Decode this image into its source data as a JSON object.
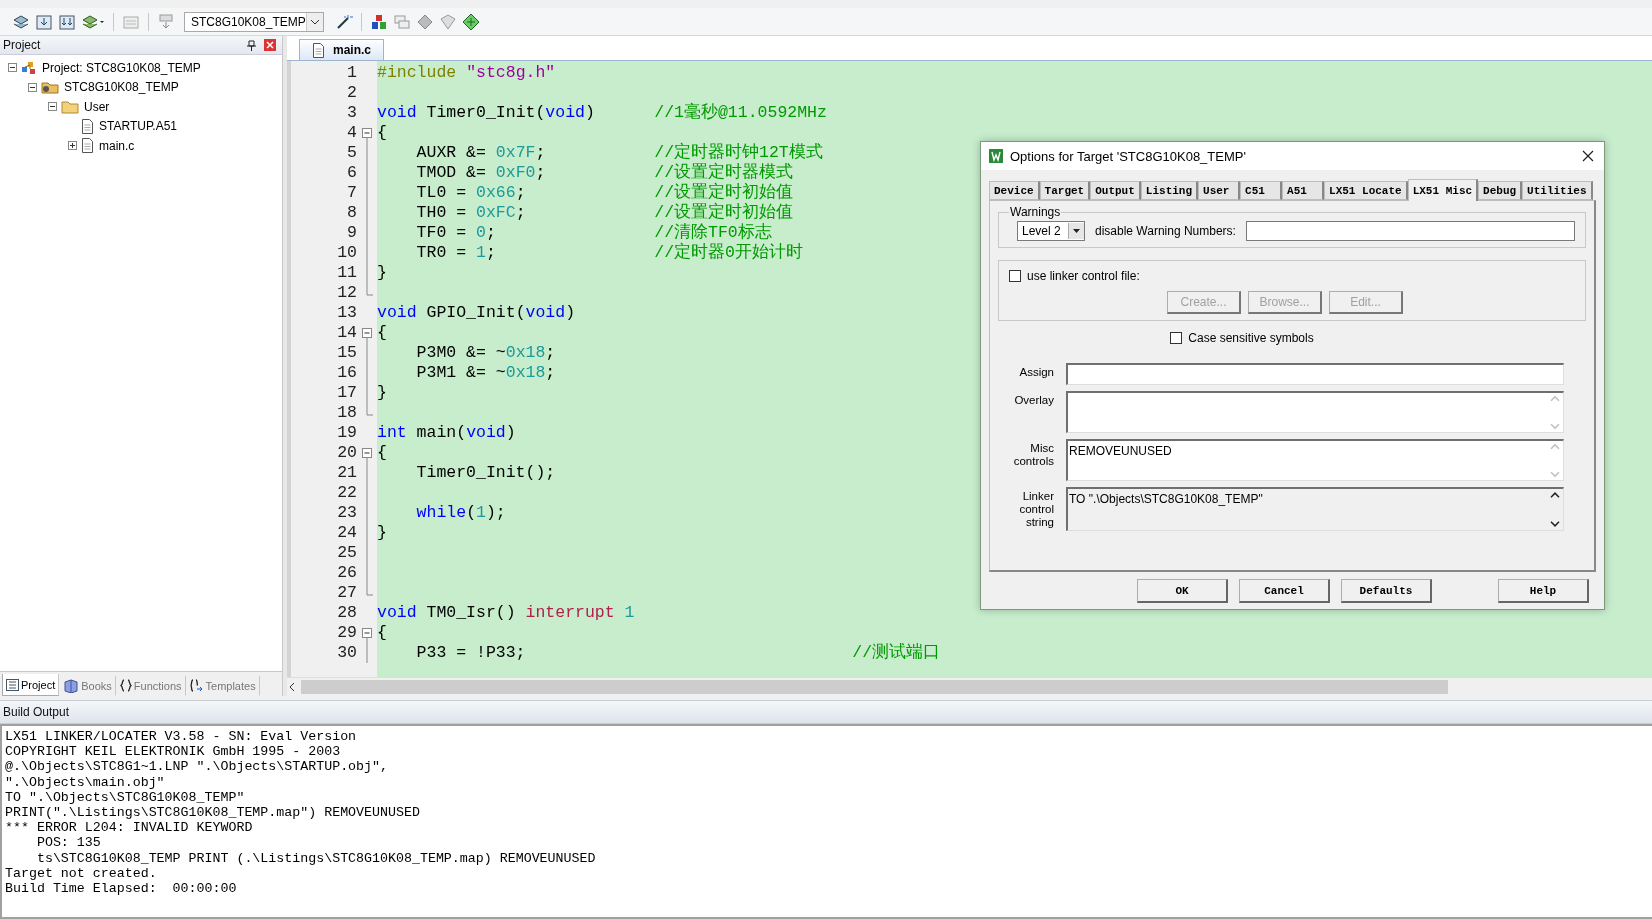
{
  "toolbar": {
    "target": "STC8G10K08_TEMP"
  },
  "project_panel": {
    "title": "Project",
    "tree": [
      {
        "label": "Project: STC8G10K08_TEMP",
        "kind": "root",
        "expanded": true,
        "children": [
          {
            "label": "STC8G10K08_TEMP",
            "kind": "target",
            "expanded": true,
            "children": [
              {
                "label": "User",
                "kind": "folder",
                "expanded": true,
                "children": [
                  {
                    "label": "STARTUP.A51",
                    "kind": "file"
                  },
                  {
                    "label": "main.c",
                    "kind": "file",
                    "expanded": false
                  }
                ]
              }
            ]
          }
        ]
      }
    ],
    "tabs": [
      {
        "label": "Project",
        "kind": "project",
        "selected": true
      },
      {
        "label": "Books",
        "kind": "books",
        "selected": false
      },
      {
        "label": "Functions",
        "kind": "functions",
        "selected": false
      },
      {
        "label": "Templates",
        "kind": "templates",
        "selected": false
      }
    ]
  },
  "editor": {
    "tabs": [
      {
        "label": "main.c",
        "selected": true
      }
    ],
    "lines": [
      {
        "number": "1",
        "kind": "plain",
        "tokens": [
          {
            "kind": "pre",
            "text": "#include "
          },
          {
            "kind": "str",
            "text": "\"stc8g.h\""
          }
        ]
      },
      {
        "number": "2",
        "kind": "plain"
      },
      {
        "number": "3",
        "kind": "plain",
        "tokens": [
          {
            "kind": "kw",
            "text": "void"
          },
          {
            "kind": "txt",
            "text": " Timer0_Init("
          },
          {
            "kind": "kw",
            "text": "void"
          },
          {
            "kind": "txt",
            "text": ")      "
          },
          {
            "kind": "cm",
            "text": "//1毫秒@11.0592MHz"
          }
        ]
      },
      {
        "number": "4",
        "kind": "fold_start",
        "tokens": [
          {
            "kind": "txt",
            "text": "{"
          }
        ]
      },
      {
        "number": "5",
        "kind": "fold_body",
        "tokens": [
          {
            "kind": "txt",
            "text": "    AUXR &= "
          },
          {
            "kind": "num",
            "text": "0x7F"
          },
          {
            "kind": "txt",
            "text": ";           "
          },
          {
            "kind": "cm",
            "text": "//定时器时钟12T模式"
          }
        ]
      },
      {
        "number": "6",
        "kind": "fold_body",
        "tokens": [
          {
            "kind": "txt",
            "text": "    TMOD &= "
          },
          {
            "kind": "num",
            "text": "0xF0"
          },
          {
            "kind": "txt",
            "text": ";           "
          },
          {
            "kind": "cm",
            "text": "//设置定时器模式"
          }
        ]
      },
      {
        "number": "7",
        "kind": "fold_body",
        "tokens": [
          {
            "kind": "txt",
            "text": "    TL0 = "
          },
          {
            "kind": "num",
            "text": "0x66"
          },
          {
            "kind": "txt",
            "text": ";             "
          },
          {
            "kind": "cm",
            "text": "//设置定时初始值"
          }
        ]
      },
      {
        "number": "8",
        "kind": "fold_body",
        "tokens": [
          {
            "kind": "txt",
            "text": "    TH0 = "
          },
          {
            "kind": "num",
            "text": "0xFC"
          },
          {
            "kind": "txt",
            "text": ";             "
          },
          {
            "kind": "cm",
            "text": "//设置定时初始值"
          }
        ]
      },
      {
        "number": "9",
        "kind": "fold_body",
        "tokens": [
          {
            "kind": "txt",
            "text": "    TF0 = "
          },
          {
            "kind": "num",
            "text": "0"
          },
          {
            "kind": "txt",
            "text": ";                "
          },
          {
            "kind": "cm",
            "text": "//清除TF0标志"
          }
        ]
      },
      {
        "number": "10",
        "kind": "fold_body",
        "tokens": [
          {
            "kind": "txt",
            "text": "    TR0 = "
          },
          {
            "kind": "num",
            "text": "1"
          },
          {
            "kind": "txt",
            "text": ";                "
          },
          {
            "kind": "cm",
            "text": "//定时器0开始计时"
          }
        ]
      },
      {
        "number": "11",
        "kind": "fold_body",
        "tokens": [
          {
            "kind": "txt",
            "text": "}"
          }
        ]
      },
      {
        "number": "12",
        "kind": "fold_end"
      },
      {
        "number": "13",
        "kind": "plain",
        "tokens": [
          {
            "kind": "kw",
            "text": "void"
          },
          {
            "kind": "txt",
            "text": " GPIO_Init("
          },
          {
            "kind": "kw",
            "text": "void"
          },
          {
            "kind": "txt",
            "text": ")"
          }
        ]
      },
      {
        "number": "14",
        "kind": "fold_start",
        "tokens": [
          {
            "kind": "txt",
            "text": "{"
          }
        ]
      },
      {
        "number": "15",
        "kind": "fold_body",
        "tokens": [
          {
            "kind": "txt",
            "text": "    P3M0 &= ~"
          },
          {
            "kind": "num",
            "text": "0x18"
          },
          {
            "kind": "txt",
            "text": ";"
          }
        ]
      },
      {
        "number": "16",
        "kind": "fold_body",
        "tokens": [
          {
            "kind": "txt",
            "text": "    P3M1 &= ~"
          },
          {
            "kind": "num",
            "text": "0x18"
          },
          {
            "kind": "txt",
            "text": ";"
          }
        ]
      },
      {
        "number": "17",
        "kind": "fold_body",
        "tokens": [
          {
            "kind": "txt",
            "text": "}"
          }
        ]
      },
      {
        "number": "18",
        "kind": "fold_end"
      },
      {
        "number": "19",
        "kind": "plain",
        "tokens": [
          {
            "kind": "kw",
            "text": "int"
          },
          {
            "kind": "txt",
            "text": " main("
          },
          {
            "kind": "kw",
            "text": "void"
          },
          {
            "kind": "txt",
            "text": ")"
          }
        ]
      },
      {
        "number": "20",
        "kind": "fold_start",
        "tokens": [
          {
            "kind": "txt",
            "text": "{"
          }
        ]
      },
      {
        "number": "21",
        "kind": "fold_body",
        "tokens": [
          {
            "kind": "txt",
            "text": "    Timer0_Init();"
          }
        ]
      },
      {
        "number": "22",
        "kind": "fold_body"
      },
      {
        "number": "23",
        "kind": "fold_body",
        "tokens": [
          {
            "kind": "kw",
            "text": "    while"
          },
          {
            "kind": "txt",
            "text": "("
          },
          {
            "kind": "num",
            "text": "1"
          },
          {
            "kind": "txt",
            "text": ");"
          }
        ]
      },
      {
        "number": "24",
        "kind": "fold_body",
        "tokens": [
          {
            "kind": "txt",
            "text": "}"
          }
        ]
      },
      {
        "number": "25",
        "kind": "fold_body"
      },
      {
        "number": "26",
        "kind": "fold_body"
      },
      {
        "number": "27",
        "kind": "fold_end"
      },
      {
        "number": "28",
        "kind": "plain",
        "tokens": [
          {
            "kind": "kw",
            "text": "void"
          },
          {
            "kind": "txt",
            "text": " TM0_Isr() "
          },
          {
            "kind": "isr",
            "text": "interrupt "
          },
          {
            "kind": "num",
            "text": "1"
          }
        ]
      },
      {
        "number": "29",
        "kind": "fold_start",
        "tokens": [
          {
            "kind": "txt",
            "text": "{"
          }
        ]
      },
      {
        "number": "30",
        "kind": "fold_body",
        "tokens": [
          {
            "kind": "txt",
            "text": "    P33 = !P33;                                 "
          },
          {
            "kind": "cm",
            "text": "//测试端口"
          }
        ]
      }
    ]
  },
  "build_output": {
    "title": "Build Output",
    "lines": [
      "LX51 LINKER/LOCATER V3.58 - SN: Eval Version",
      "COPYRIGHT KEIL ELEKTRONIK GmbH 1995 - 2003",
      "@.\\Objects\\STC8G1~1.LNP \".\\Objects\\STARTUP.obj\",",
      "\".\\Objects\\main.obj\"",
      "TO \".\\Objects\\STC8G10K08_TEMP\"",
      "PRINT(\".\\Listings\\STC8G10K08_TEMP.map\") REMOVEUNUSED",
      "*** ERROR L204: INVALID KEYWORD",
      "    POS: 135",
      "    ts\\STC8G10K08_TEMP PRINT (.\\Listings\\STC8G10K08_TEMP.map) REMOVEUNUSED",
      "Target not created.",
      "Build Time Elapsed:  00:00:00"
    ]
  },
  "dialog": {
    "title": "Options for Target 'STC8G10K08_TEMP'",
    "tabs": [
      {
        "label": "Device",
        "selected": false
      },
      {
        "label": "Target",
        "selected": false
      },
      {
        "label": "Output",
        "selected": false
      },
      {
        "label": "Listing",
        "selected": false
      },
      {
        "label": "User",
        "selected": false
      },
      {
        "label": "C51",
        "selected": false
      },
      {
        "label": "A51",
        "selected": false
      },
      {
        "label": "LX51 Locate",
        "selected": false
      },
      {
        "label": "LX51 Misc",
        "selected": true
      },
      {
        "label": "Debug",
        "selected": false
      },
      {
        "label": "Utilities",
        "selected": false
      }
    ],
    "warnings": {
      "label": "Warnings",
      "level": "Level 2",
      "disable_label": "disable Warning Numbers:"
    },
    "linker_file": {
      "label": "use linker control file:",
      "checked": false,
      "buttons": [
        {
          "label": "Create...",
          "disabled": true
        },
        {
          "label": "Browse...",
          "disabled": true
        },
        {
          "label": "Edit...",
          "disabled": true
        }
      ]
    },
    "case_sensitive": {
      "label": "Case sensitive symbols",
      "checked": false
    },
    "fields": [
      {
        "label": "Assign",
        "kind": "single"
      },
      {
        "label": "Overlay",
        "kind": "multi"
      },
      {
        "label": "Misc controls",
        "kind": "multi",
        "value": "REMOVEUNUSED"
      },
      {
        "label": "Linker control string",
        "kind": "readonly",
        "value": "TO \".\\Objects\\STC8G10K08_TEMP\""
      }
    ],
    "buttons": [
      "OK",
      "Cancel",
      "Defaults",
      "Help"
    ]
  }
}
